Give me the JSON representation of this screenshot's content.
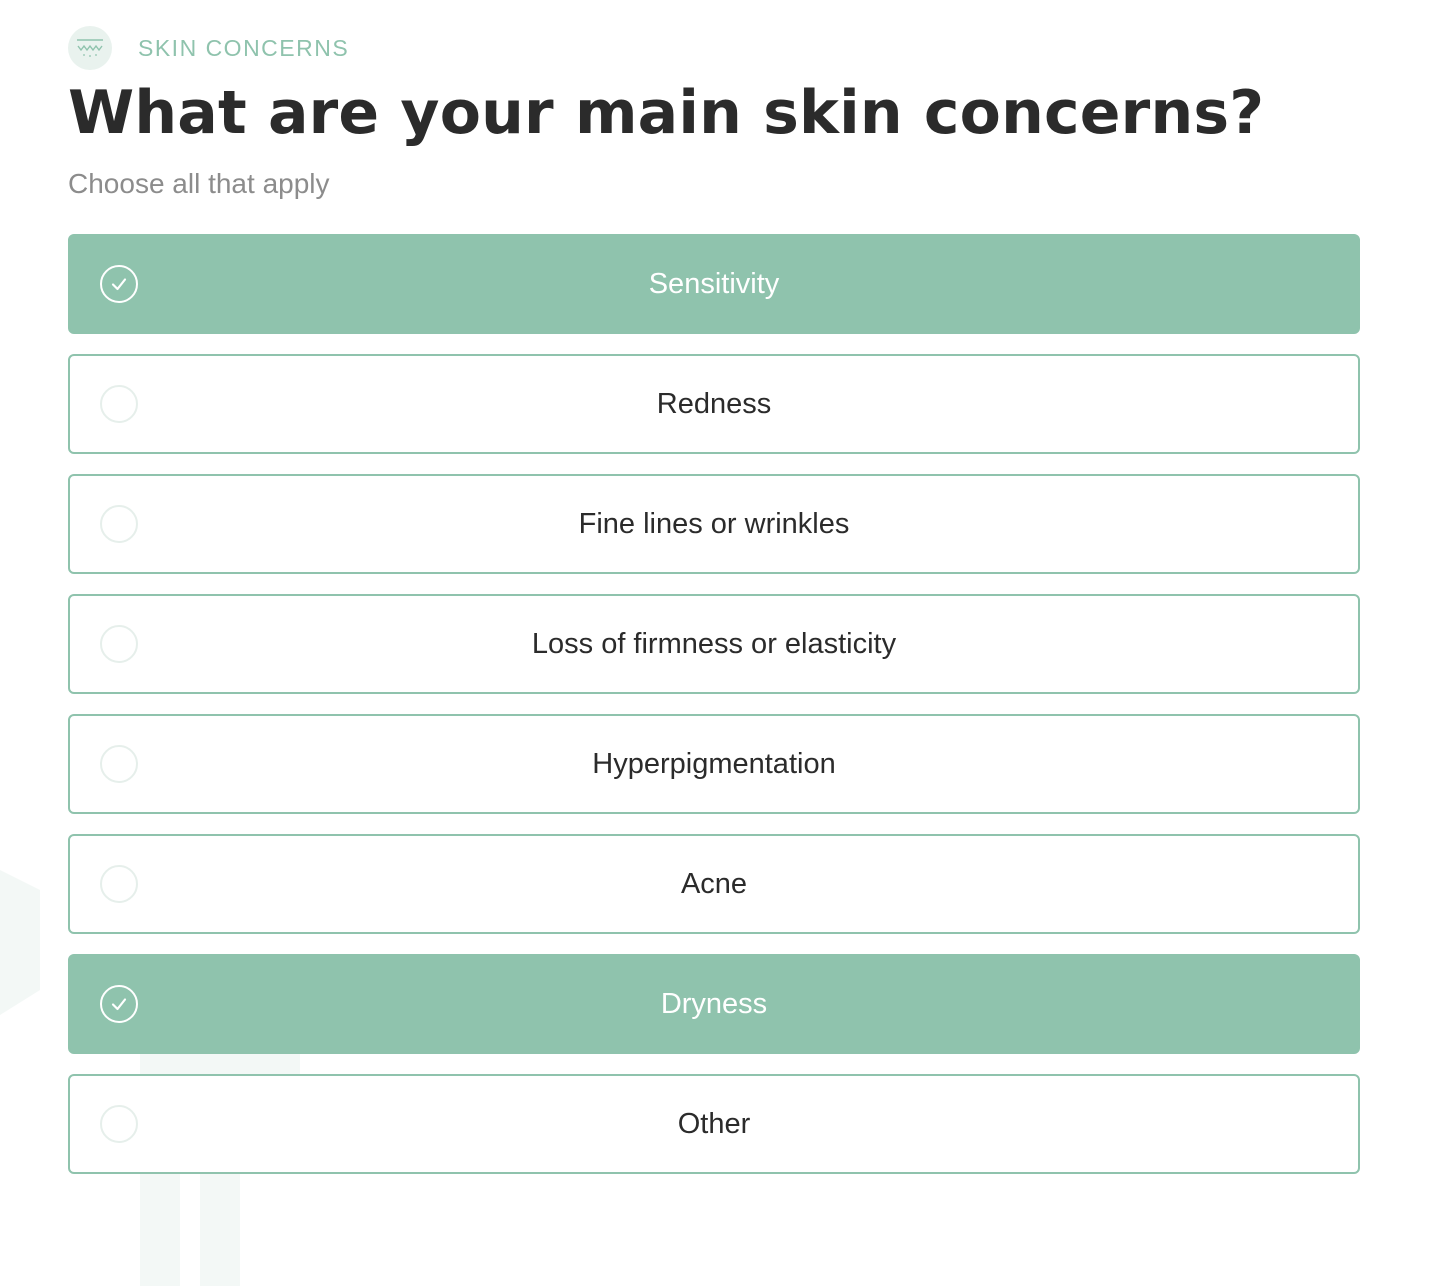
{
  "header": {
    "icon": "skin-waves-icon",
    "section_label": "SKIN CONCERNS",
    "title": "What are your main skin concerns?",
    "subtitle": "Choose all that apply"
  },
  "options": [
    {
      "label": "Sensitivity",
      "selected": true
    },
    {
      "label": "Redness",
      "selected": false
    },
    {
      "label": "Fine lines or wrinkles",
      "selected": false
    },
    {
      "label": "Loss of firmness or elasticity",
      "selected": false
    },
    {
      "label": "Hyperpigmentation",
      "selected": false
    },
    {
      "label": "Acne",
      "selected": false
    },
    {
      "label": "Dryness",
      "selected": true
    },
    {
      "label": "Other",
      "selected": false
    }
  ],
  "colors": {
    "accent": "#8fc3ad",
    "title": "#2b2b2b",
    "subtitle": "#8c8c8c",
    "unchecked_ring": "#e6efeb"
  }
}
